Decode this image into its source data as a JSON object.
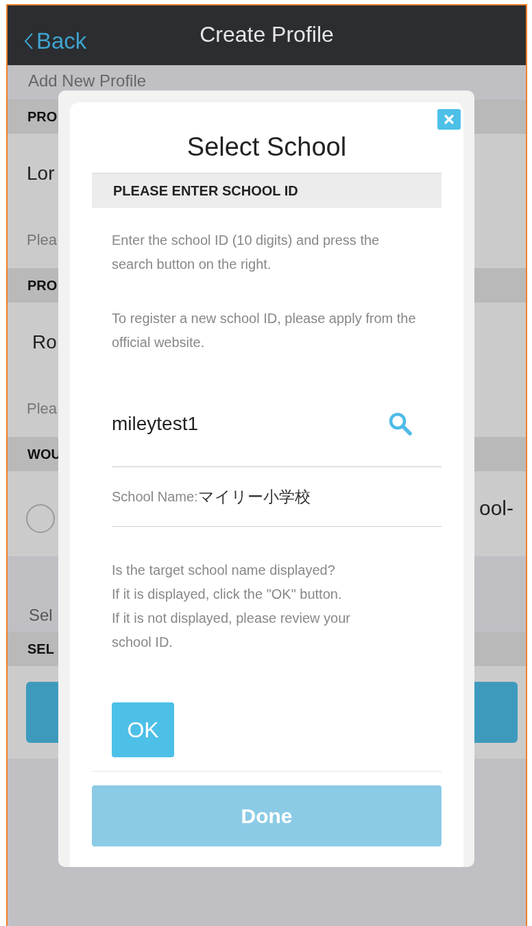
{
  "nav_bar": {
    "back": "Back",
    "title": "Create Profile"
  },
  "background": {
    "subtitle": "Add New Profile",
    "rows": [
      {
        "kind": "section",
        "text": "PRO"
      },
      {
        "kind": "field",
        "text": "Lor",
        "hint": "Plea"
      },
      {
        "kind": "section",
        "text": "PRO"
      },
      {
        "kind": "field",
        "text": "Ro",
        "hint": "Plea"
      },
      {
        "kind": "section",
        "text": "WOU"
      },
      {
        "kind": "radio",
        "text": "ool-",
        "checked": false
      },
      {
        "kind": "label",
        "text": "Sel"
      },
      {
        "kind": "section",
        "text": "SEL"
      },
      {
        "kind": "button"
      }
    ]
  },
  "dialog": {
    "title": "Select School",
    "section": "PLEASE ENTER SCHOOL ID",
    "instructions": [
      "Enter the school ID (10 digits) and press the search button on the right.",
      "To register a new school ID, please apply from the official website."
    ],
    "school_id": {
      "value": "mileytest1"
    },
    "school_name": {
      "label": "School Name:",
      "value": "マイリー小学校"
    },
    "confirm_text": [
      "Is the target school name displayed?",
      "If it is displayed, click the \"OK\" button.",
      "If it is not displayed, please review your school ID."
    ],
    "ok_button": "OK",
    "done_button": {
      "label": "Done",
      "disabled": true
    }
  }
}
